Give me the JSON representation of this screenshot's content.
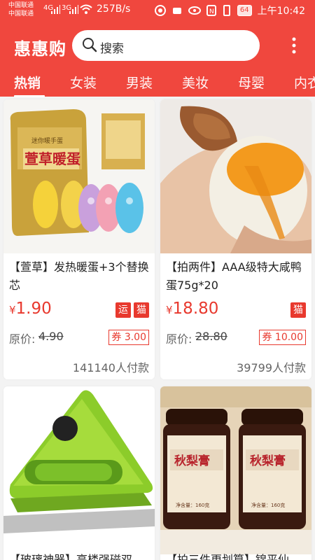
{
  "status": {
    "carrier1": "中国联通",
    "carrier2": "中国联通",
    "sig1": "4G",
    "sig2": "3G",
    "speed": "257B/s",
    "battery": "64",
    "time": "上午10:42"
  },
  "header": {
    "app_title": "惠惠购",
    "search_placeholder": "搜索"
  },
  "tabs": [
    "热销",
    "女装",
    "男装",
    "美妆",
    "母婴",
    "内衣"
  ],
  "products": [
    {
      "title": "【萱草】发热暖蛋+3个替换芯",
      "currency": "¥",
      "price": "1.90",
      "tags": [
        "运",
        "猫"
      ],
      "orig_label": "原价:",
      "orig_price": "4.90",
      "coupon": "券 3.00",
      "sold": "141140人付款",
      "img_text": "萱草暖蛋",
      "img_sub": "迷你暖手蛋"
    },
    {
      "title": "【拍两件】AAA级特大咸鸭蛋75g*20",
      "currency": "¥",
      "price": "18.80",
      "tags": [
        "猫"
      ],
      "orig_label": "原价:",
      "orig_price": "28.80",
      "coupon": "券 10.00",
      "sold": "39799人付款"
    },
    {
      "title": "【玻璃神器】高楼强磁双"
    },
    {
      "title": "【拍三件更划算】锦平仙",
      "img_text": "秋梨膏",
      "img_sub": "净含量：160克"
    }
  ]
}
